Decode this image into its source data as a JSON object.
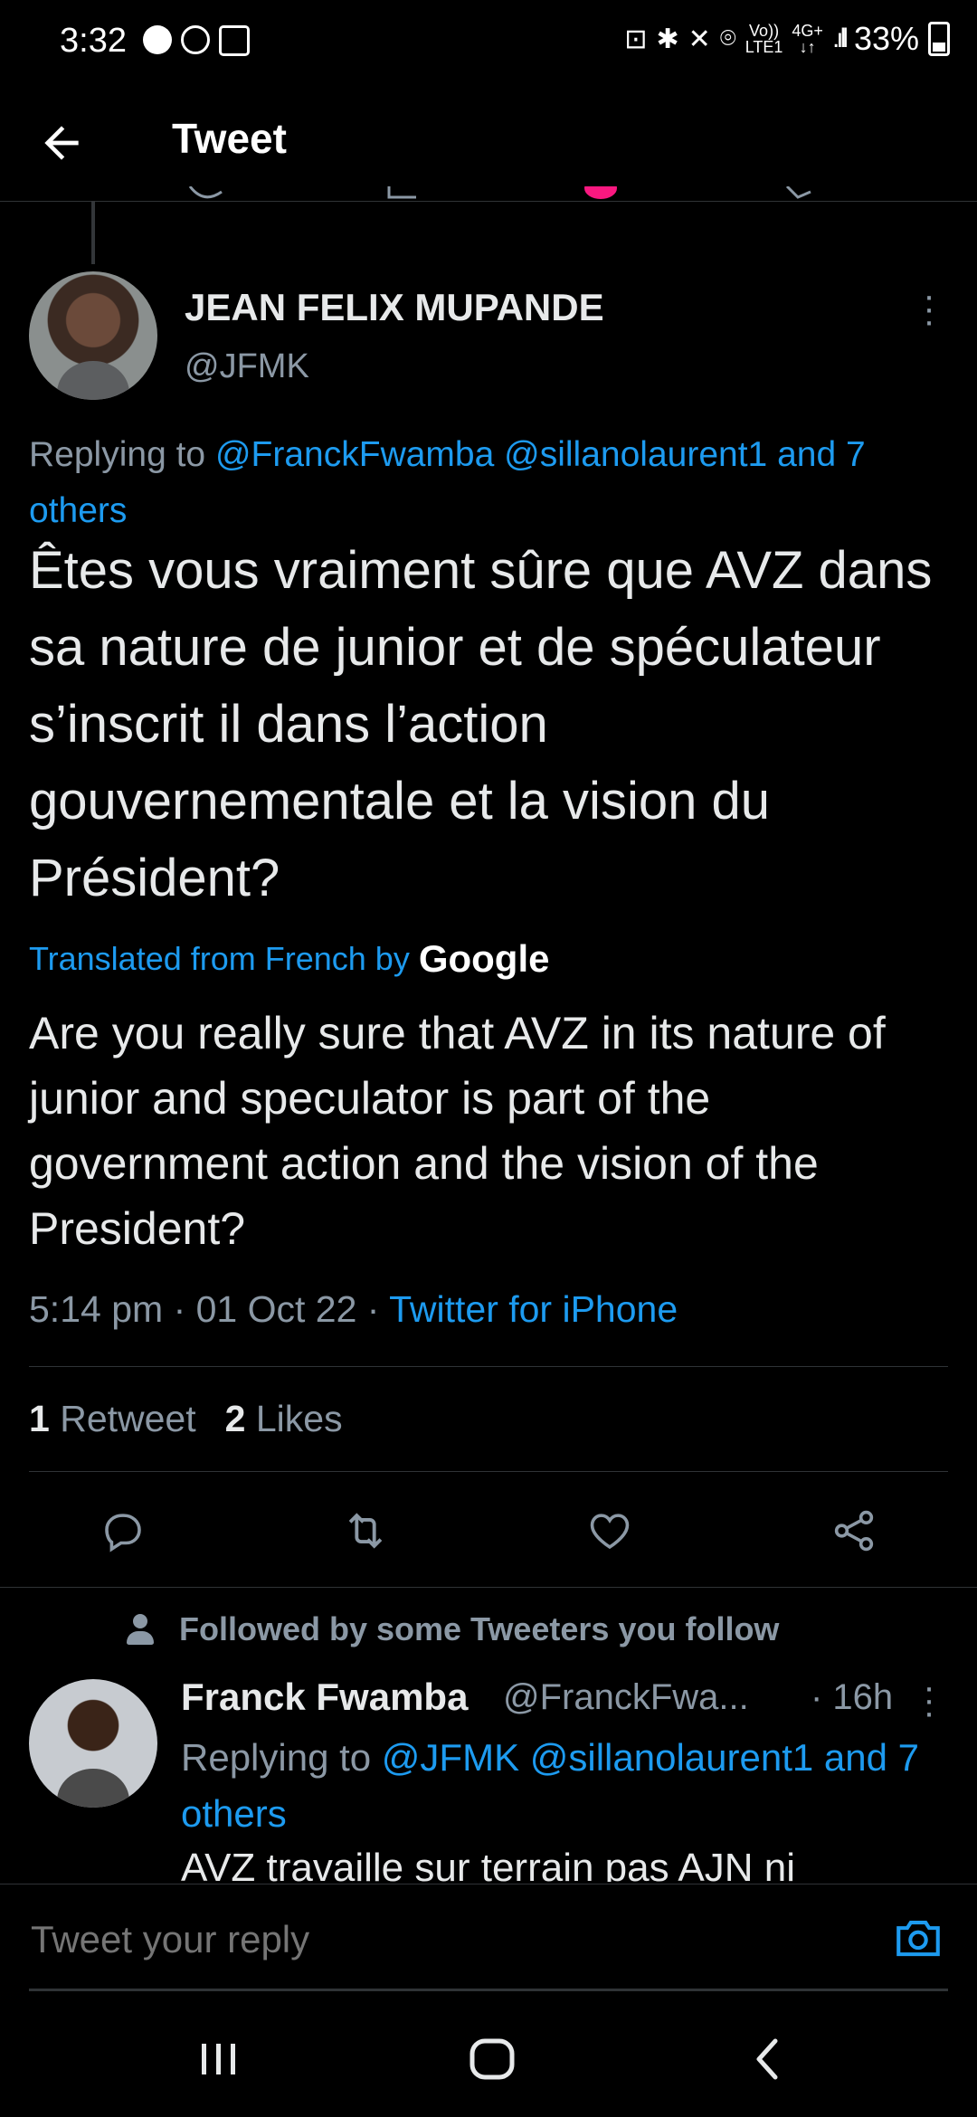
{
  "status_bar": {
    "time": "3:32",
    "battery": "33%",
    "network_top": "Vo))",
    "network_bottom": "LTE1",
    "data_top": "4G+",
    "data_bottom": "↓↑"
  },
  "header": {
    "title": "Tweet"
  },
  "tweet": {
    "author_name": "JEAN FELIX MUPANDE",
    "author_handle": "@JFMK",
    "replying_prefix": "Replying to",
    "replying_links": "@FranckFwamba @sillanolaurent1",
    "replying_others": "and 7 others",
    "body_fr": "Êtes vous vraiment sûre que AVZ dans sa nature de junior et de spéculateur s’inscrit il dans l’action gouvernementale et la vision du Président?",
    "translated_label": "Translated from French by",
    "translated_provider": "Google",
    "body_en": "Are you really sure that AVZ in its nature of junior and speculator is part of the government action and the vision of the President?",
    "time": "5:14 pm",
    "date": "01 Oct 22",
    "source": "Twitter for iPhone",
    "retweet_count": "1",
    "retweet_label": "Retweet",
    "like_count": "2",
    "like_label": "Likes"
  },
  "reply": {
    "social_context": "Followed by some Tweeters you follow",
    "author_name": "Franck Fwamba",
    "author_handle": "@FranckFwa...",
    "time": "· 16h",
    "replying_prefix": "Replying to",
    "replying_links": "@JFMK @sillanolaurent1 and 7 others",
    "body": "AVZ travaille sur terrain pas AJN ni"
  },
  "reply_bar": {
    "placeholder": "Tweet your reply"
  },
  "colors": {
    "background": "#000000",
    "text": "#e7e9ea",
    "secondary": "#8b98a5",
    "link": "#1d9bf0",
    "like_pink": "#f91880"
  },
  "icons": [
    "back-arrow-icon",
    "reply-icon",
    "retweet-icon",
    "like-icon",
    "share-icon",
    "camera-icon",
    "more-icon",
    "person-icon"
  ]
}
